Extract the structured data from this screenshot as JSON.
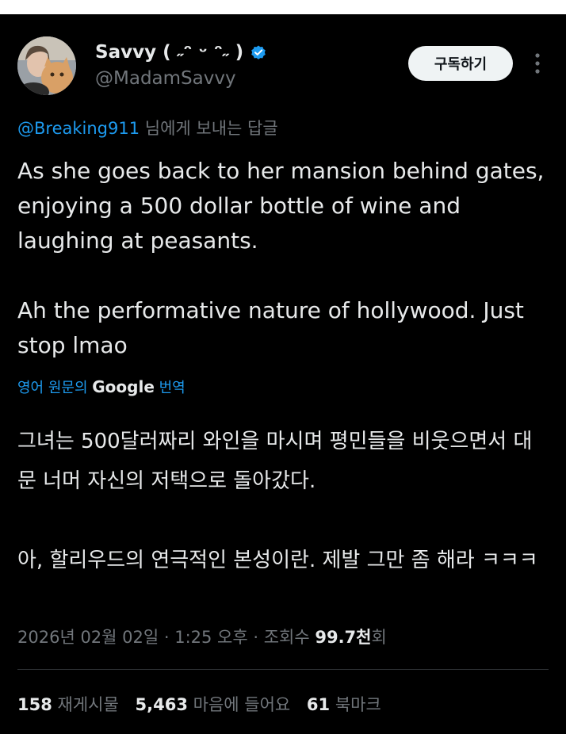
{
  "author": {
    "display_name": "Savvy ( ˶ᵔ ᵕ ᵔ˶ )",
    "handle": "@MadamSavvy",
    "avatar_icon": "avatar-woman-with-cat",
    "verified_icon": "verified-badge-icon"
  },
  "actions": {
    "subscribe_label": "구독하기",
    "more_icon": "more-options-icon"
  },
  "reply": {
    "mention": "@Breaking911",
    "suffix": " 님에게 보내는 답글"
  },
  "tweet": {
    "text": "As she goes back to her mansion behind gates, enjoying a 500 dollar bottle of wine and laughing at peasants.\n\nAh the performative nature of hollywood. Just stop lmao"
  },
  "translation": {
    "prefix": "영어 원문의 ",
    "brand": "Google",
    "suffix": " 번역",
    "text": "그녀는 500달러짜리 와인을 마시며 평민들을 비웃으면서 대문 너머 자신의 저택으로 돌아갔다.\n\n아, 할리우드의 연극적인 본성이란. 제발 그만 좀 해라 ㅋㅋㅋ"
  },
  "meta": {
    "timestamp": "2026년 02월 02일 · 1:25 오후 · 조회수 ",
    "views": "99.7천",
    "views_suffix": "회"
  },
  "stats": {
    "reposts_count": "158",
    "reposts_label": "재게시물",
    "likes_count": "5,463",
    "likes_label": "마음에 들어요",
    "bookmarks_count": "61",
    "bookmarks_label": "북마크"
  },
  "colors": {
    "background": "#000000",
    "accent": "#1d9bf0",
    "text_primary": "#e7e9ea",
    "text_secondary": "#71767b"
  }
}
